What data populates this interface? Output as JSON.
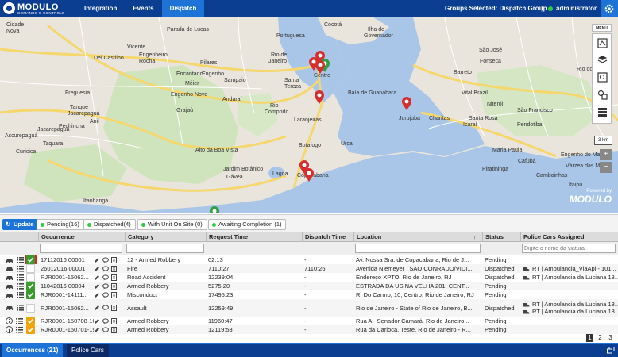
{
  "header": {
    "logo_brand": "MODULO",
    "logo_sub": "COMANDO E CONTROLE",
    "nav": [
      {
        "label": "Integration"
      },
      {
        "label": "Events"
      },
      {
        "label": "Dispatch"
      }
    ],
    "groups_selected": "Groups Selected: Dispatch Group",
    "separator": "|",
    "user": "administrator"
  },
  "map": {
    "menu_label": "MENU",
    "scale": "3 km",
    "zoom_in": "+",
    "zoom_out": "−",
    "powered_by": "Powered by",
    "powered_brand": "MODULO",
    "labels": [
      "Cidade",
      "Nova",
      "Parada de Lucas",
      "Vicente",
      "Engenheiro",
      "Rocha",
      "Del Castilho",
      "Engenho",
      "Encantado",
      "Pilares",
      "Méier",
      "Sampaio",
      "Engenho Novo",
      "Grajaú",
      "Andaraí",
      "Rio de",
      "Janeiro",
      "Centro",
      "Rio",
      "Comprido",
      "Laranjeiras",
      "Jurujuba",
      "Charitas",
      "Icaraí",
      "Niterói",
      "Itaipu",
      "Piratininga",
      "Camboinhas",
      "Pendotiba",
      "Maria Paula",
      "Alto da Boa Vista",
      "Jardim Botânico",
      "Botafogo",
      "Urca",
      "Lagoa",
      "Copacabana",
      "Jacarepaguá",
      "Itanhangá",
      "Gávea",
      "Tanque",
      "Jacarepaguá",
      "Anil",
      "Curicica",
      "Taquara",
      "Accurepaguá",
      "Freguesia",
      "Pechincha",
      "Santa",
      "Tereza",
      "Ilha do",
      "Governador",
      "Portuguesa",
      "Cocotá",
      "Baía de Guanabara",
      "Vital Brazil",
      "Fonseca",
      "Barreto",
      "Santa Rosa",
      "São Francisco",
      "Cafubá",
      "Engenho do Mato",
      "Rio do Ouro",
      "Várzea das Moças",
      "São José"
    ]
  },
  "filters": {
    "update": "Update",
    "tabs": [
      "Pending(16)",
      "Dispatched(4)",
      "With Unit On Site (0)",
      "Awaiting Completion (1)"
    ]
  },
  "table": {
    "columns": [
      "Occurrence",
      "Category",
      "Request Time",
      "Dispatch Time",
      "Location",
      "Status",
      "Police Cars Assigned"
    ],
    "sort_indicator": "↑",
    "police_placeholder": "Digite o nome da viatura",
    "rows": [
      {
        "occurrence": "17112016 00001",
        "category": "12 - Armed Robbery",
        "request": "02:13",
        "dispatch": "-",
        "location": "Av. Nossa Sra. de Copacabana, Rio de J...",
        "status": "Pending",
        "cars": [],
        "check": "green",
        "highlight": true
      },
      {
        "occurrence": "26012016 00001",
        "category": "Fire",
        "request": "7110:27",
        "dispatch": "7110:26",
        "location": "Avenida Niemeyer , SAO CONRADO/VIDI...",
        "status": "Dispatched",
        "cars": [
          "RT | Ambulancia_ViaApi - 101..."
        ],
        "check": "empty",
        "highlight": false
      },
      {
        "occurrence": "RJR0001-15062...",
        "category": "Road Accident",
        "request": "12239:04",
        "dispatch": "-",
        "location": "Endereço XPTO, Rio de Janeiro, RJ",
        "status": "Dispatched",
        "cars": [
          "RT | Ambulancia da Luciana 18..."
        ],
        "check": "empty",
        "highlight": false
      },
      {
        "occurrence": "11042016 00004",
        "category": "Armed Robbery",
        "request": "5275:20",
        "dispatch": "-",
        "location": "ESTRADA DA USINA VELHA 201, CENT...",
        "status": "Pending",
        "cars": [],
        "check": "green",
        "highlight": false
      },
      {
        "occurrence": "RJR0001-14111...",
        "category": "Misconduct",
        "request": "17495:23",
        "dispatch": "-",
        "location": "R. Do Carmo, 10, Centro, Rio de Janeiro, RJ",
        "status": "Pending",
        "cars": [],
        "check": "green",
        "highlight": false
      },
      {
        "occurrence": "RJR0001-15062...",
        "category": "Assault",
        "request": "12259:49",
        "dispatch": "-",
        "location": "Rio de Janeiro - State of Rio de Janeiro, B...",
        "status": "Dispatched",
        "cars": [
          "RT | Ambulancia da Luciana 18...",
          "RT | Ambulancia da Luciana 18..."
        ],
        "check": "empty",
        "highlight": false
      },
      {
        "occurrence": "RJR0001-150708-1001...",
        "category": "Armed Robbery",
        "request": "11960:47",
        "dispatch": "-",
        "location": "Rua A - Senador Camará, Rio de Janeiro...",
        "status": "Pending",
        "cars": [],
        "check": "orange",
        "highlight": false
      },
      {
        "occurrence": "RJR0001-150701-1902...",
        "category": "Armed Robbery",
        "request": "12119:53",
        "dispatch": "-",
        "location": "Rua da Carioca, Teste, Rio de Janeiro - R...",
        "status": "Pending",
        "cars": [],
        "check": "orange",
        "highlight": false
      }
    ]
  },
  "pager": {
    "pages": [
      "1",
      "2",
      "3"
    ],
    "current": "1"
  },
  "bottom": {
    "tabs": [
      "Occurrences (21)",
      "Police Cars"
    ]
  },
  "colors": {
    "topbar": "#0b3d91",
    "accent": "#1e73d6",
    "pin_red": "#d62e2e",
    "pin_green": "#2f9e44",
    "check_green": "#3a9a2e",
    "check_orange": "#f0a30a"
  }
}
